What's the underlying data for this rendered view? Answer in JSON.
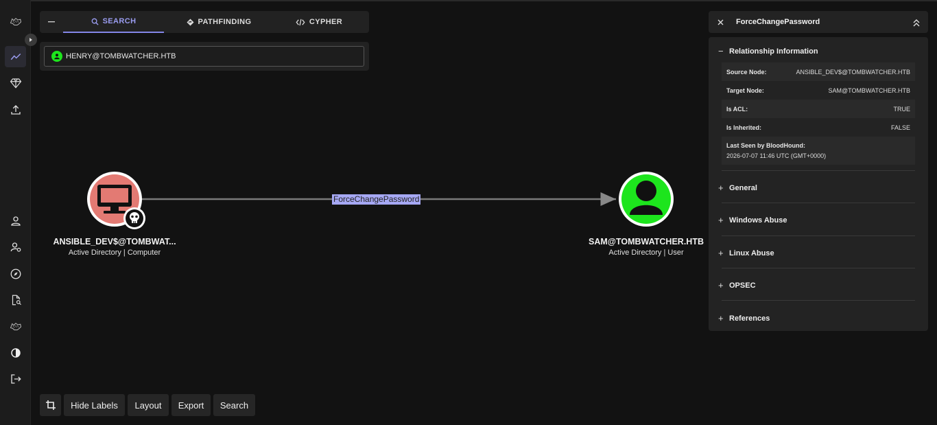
{
  "nav": {
    "items": [
      "logo",
      "explore",
      "group-management",
      "file-ingest",
      "profile",
      "administration",
      "api-explorer",
      "download-collectors",
      "bloodhound",
      "dark-mode",
      "logout"
    ]
  },
  "search_panel": {
    "tabs": [
      {
        "label": "SEARCH",
        "icon": "search-icon",
        "active": true
      },
      {
        "label": "PATHFINDING",
        "icon": "directions-icon",
        "active": false
      },
      {
        "label": "CYPHER",
        "icon": "code-icon",
        "active": false
      }
    ],
    "query_value": "HENRY@TOMBWATCHER.HTB"
  },
  "graph": {
    "source": {
      "name": "ANSIBLE_DEV$@TOMBWAT...",
      "subtitle": "Active Directory | Computer",
      "color": "#e37a73"
    },
    "target": {
      "name": "SAM@TOMBWATCHER.HTB",
      "subtitle": "Active Directory | User",
      "color": "#1de51d"
    },
    "edge_label": "ForceChangePassword"
  },
  "toolbar": {
    "hide_labels": "Hide Labels",
    "layout": "Layout",
    "export": "Export",
    "search": "Search"
  },
  "panel": {
    "title": "ForceChangePassword",
    "relationship_info": {
      "heading": "Relationship Information",
      "rows": [
        {
          "key": "Source Node:",
          "value": "ANSIBLE_DEV$@TOMBWATCHER.HTB"
        },
        {
          "key": "Target Node:",
          "value": "SAM@TOMBWATCHER.HTB"
        },
        {
          "key": "Is ACL:",
          "value": "TRUE"
        },
        {
          "key": "Is Inherited:",
          "value": "FALSE"
        }
      ],
      "last_seen_key": "Last Seen by BloodHound:",
      "last_seen_value": "2026-07-07 11:46 UTC (GMT+0000)"
    },
    "sections": [
      "General",
      "Windows Abuse",
      "Linux Abuse",
      "OPSEC",
      "References"
    ]
  }
}
